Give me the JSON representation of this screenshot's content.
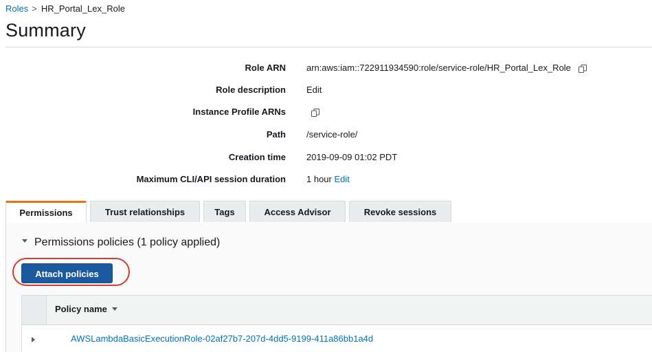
{
  "breadcrumb": {
    "root": "Roles",
    "separator": ">",
    "current": "HR_Portal_Lex_Role"
  },
  "page_title": "Summary",
  "summary": {
    "role_arn": {
      "label": "Role ARN",
      "value": "arn:aws:iam::722911934590:role/service-role/HR_Portal_Lex_Role"
    },
    "role_description": {
      "label": "Role description",
      "link": "Edit"
    },
    "instance_profile_arns": {
      "label": "Instance Profile ARNs"
    },
    "path": {
      "label": "Path",
      "value": "/service-role/"
    },
    "creation_time": {
      "label": "Creation time",
      "value": "2019-09-09 01:02 PDT"
    },
    "max_session": {
      "label": "Maximum CLI/API session duration",
      "value": "1 hour",
      "link": "Edit"
    }
  },
  "tabs": [
    {
      "label": "Permissions",
      "active": true
    },
    {
      "label": "Trust relationships",
      "active": false
    },
    {
      "label": "Tags",
      "active": false
    },
    {
      "label": "Access Advisor",
      "active": false
    },
    {
      "label": "Revoke sessions",
      "active": false
    }
  ],
  "permissions": {
    "section_title": "Permissions policies (1 policy applied)",
    "attach_button": "Attach policies",
    "table": {
      "column_header": "Policy name",
      "rows": [
        {
          "policy_name": "AWSLambdaBasicExecutionRole-02af27b7-207d-4dd5-9199-411a86bb1a4d"
        }
      ]
    }
  },
  "icons": {
    "copy": "copy-icon",
    "expand_section": "chevron-down-icon",
    "sort": "sort-down-icon",
    "expand_row": "chevron-right-icon"
  },
  "colors": {
    "link": "#0073bb",
    "primary_button": "#1c5aa0",
    "active_tab_accent": "#ec7211",
    "highlight_ring": "#d33c2c"
  }
}
